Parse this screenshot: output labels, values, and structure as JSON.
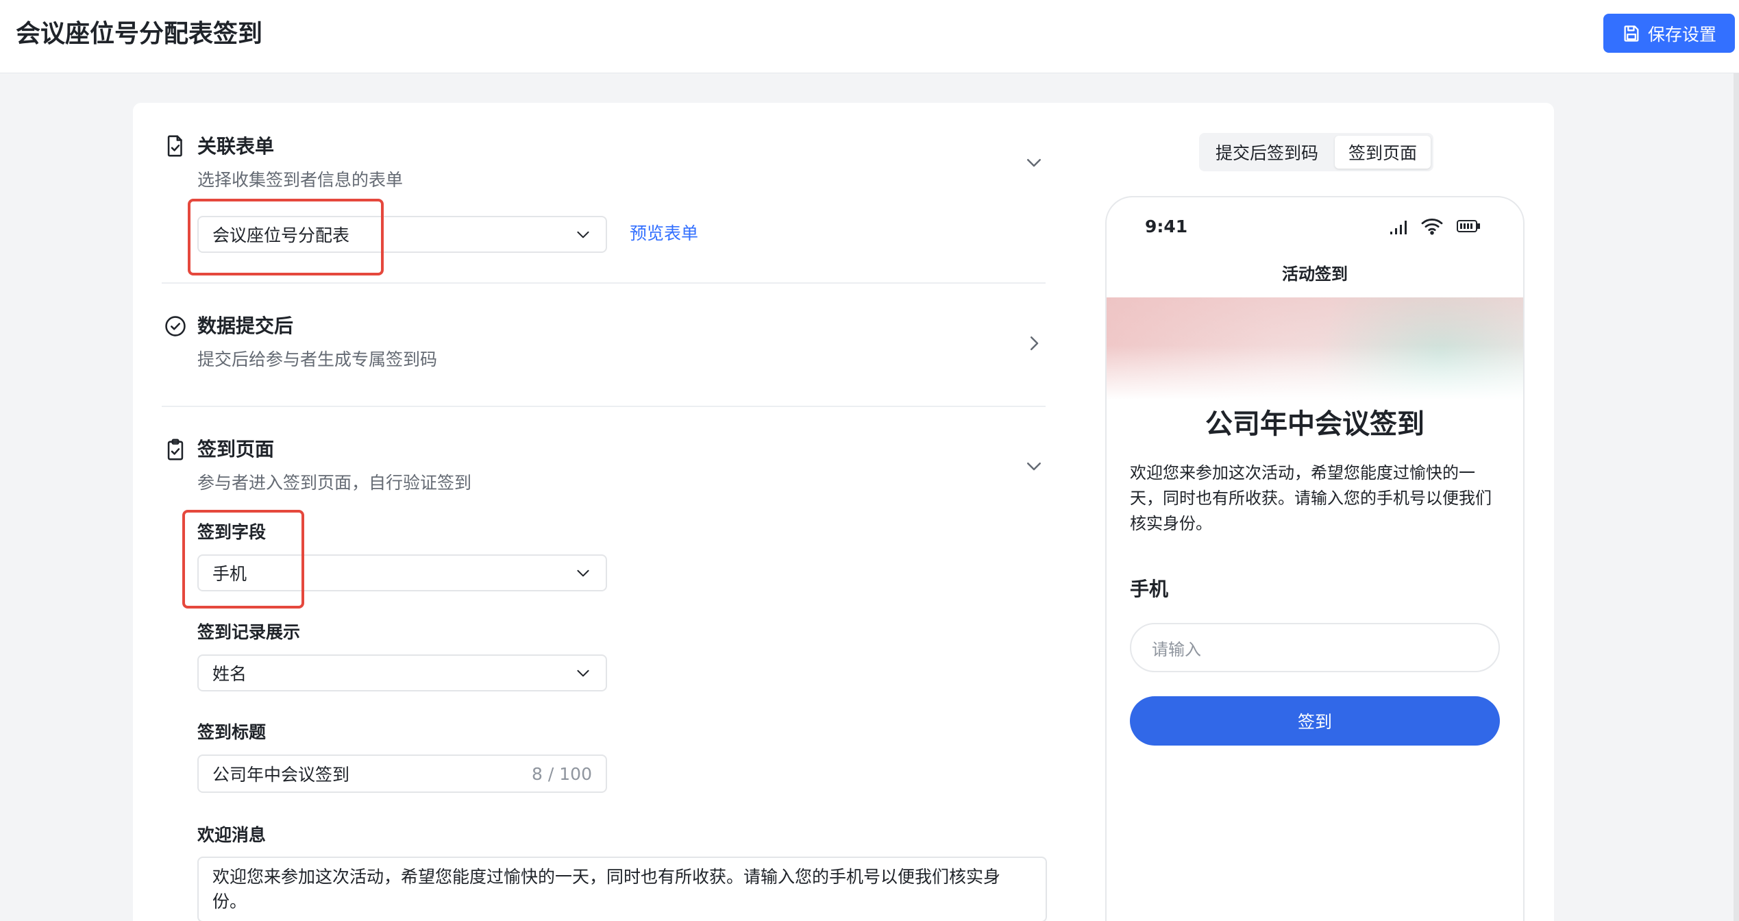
{
  "header": {
    "title": "会议座位号分配表签到",
    "save_label": "保存设置"
  },
  "sections": {
    "linked_form": {
      "title": "关联表单",
      "desc": "选择收集签到者信息的表单",
      "selected": "会议座位号分配表",
      "preview_link": "预览表单"
    },
    "after_submit": {
      "title": "数据提交后",
      "desc": "提交后给参与者生成专属签到码"
    },
    "checkin_page": {
      "title": "签到页面",
      "desc": "参与者进入签到页面，自行验证签到",
      "field_label": "签到字段",
      "field_value": "手机",
      "record_label": "签到记录展示",
      "record_value": "姓名",
      "title_label": "签到标题",
      "title_value": "公司年中会议签到",
      "title_counter": "8 / 100",
      "welcome_label": "欢迎消息",
      "welcome_value": "欢迎您来参加这次活动，希望您能度过愉快的一天，同时也有所收获。请输入您的手机号以便我们核实身份。"
    }
  },
  "preview": {
    "tabs": [
      "提交后签到码",
      "签到页面"
    ],
    "active_tab": 1,
    "phone": {
      "time": "9:41",
      "header": "活动签到",
      "title": "公司年中会议签到",
      "desc": "欢迎您来参加这次活动，希望您能度过愉快的一天，同时也有所收获。请输入您的手机号以便我们核实身份。",
      "field_label": "手机",
      "input_placeholder": "请输入",
      "button_label": "签到"
    }
  },
  "colors": {
    "primary": "#3370ff",
    "highlight": "#e5483d"
  }
}
